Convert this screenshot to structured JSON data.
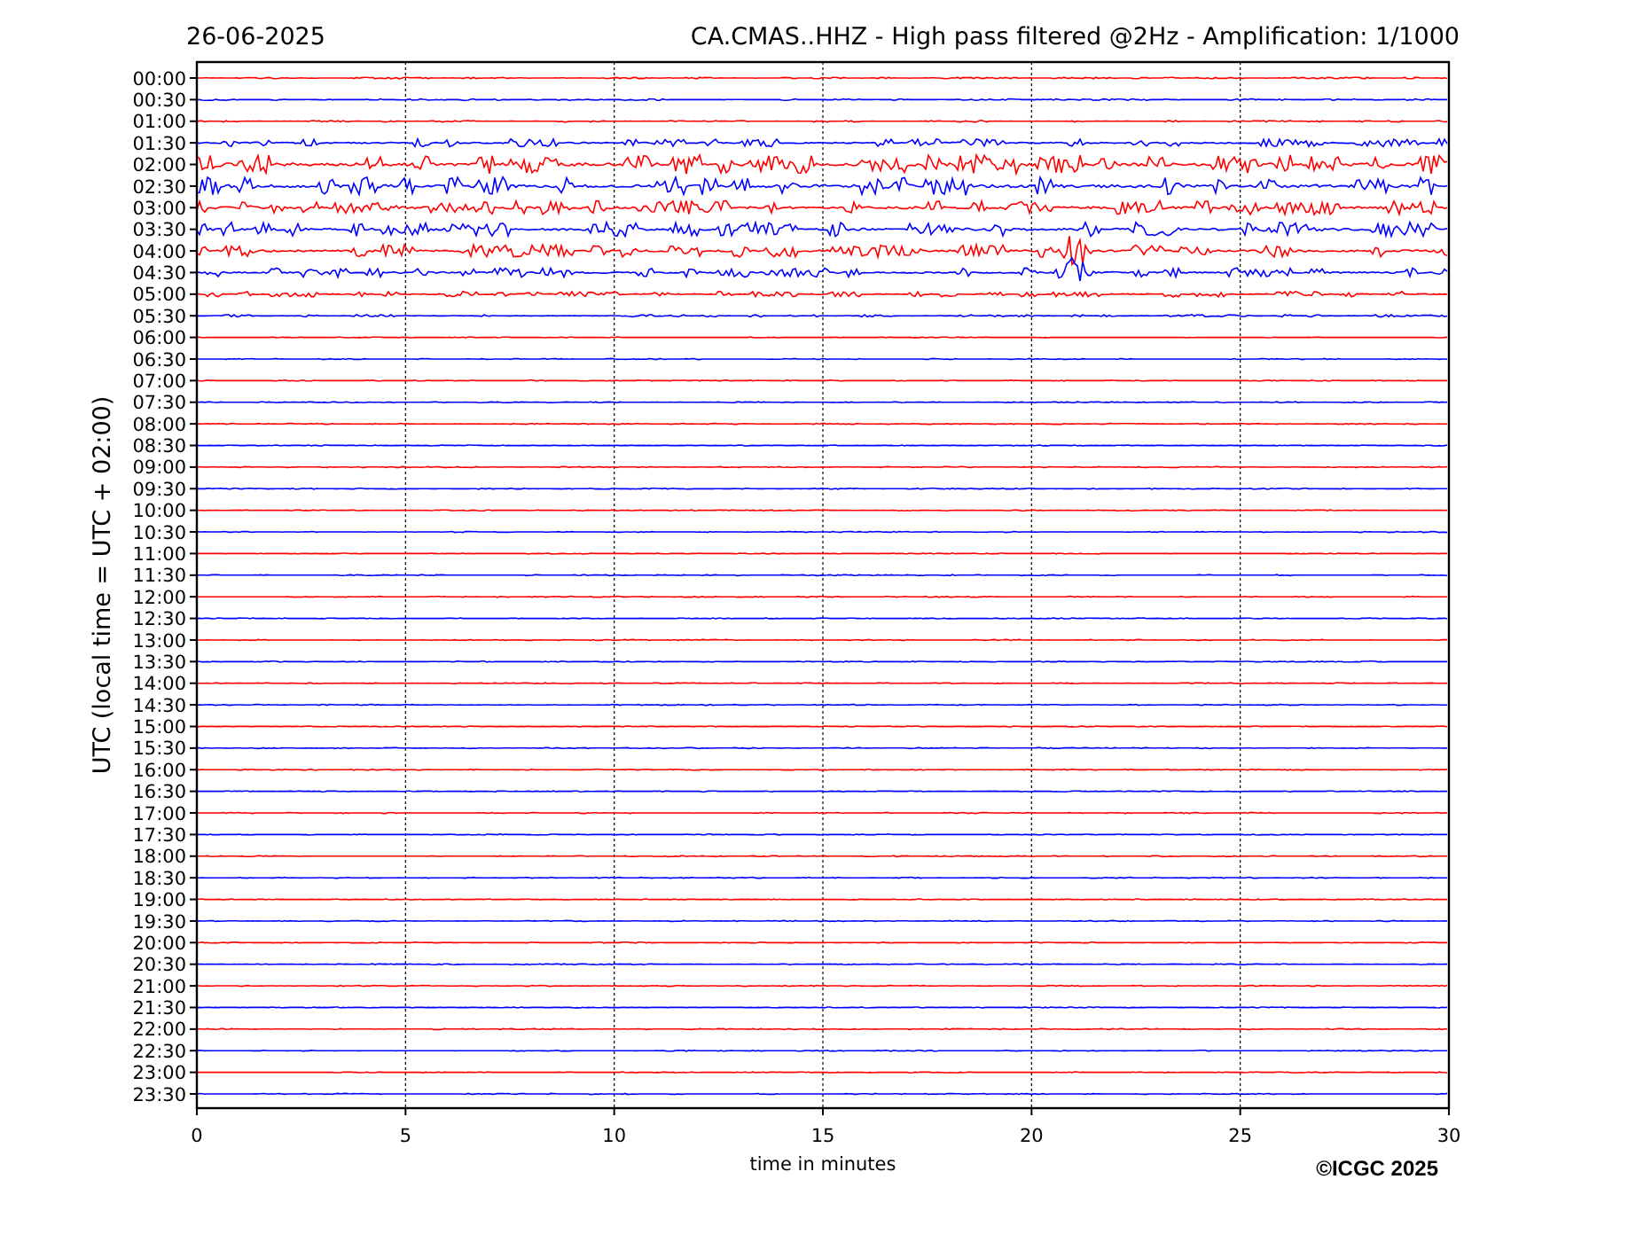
{
  "date": "26-06-2025",
  "title": "CA.CMAS..HHZ - High pass filtered @2Hz - Amplification: 1/1000",
  "ylabel": "UTC (local time = UTC + 02:00)",
  "xlabel": "time in minutes",
  "xticks": [
    "0",
    "5",
    "10",
    "15",
    "20",
    "25",
    "30"
  ],
  "rows": [
    {
      "label": "00:00",
      "color": "#ff0000"
    },
    {
      "label": "00:30",
      "color": "#0000ff"
    },
    {
      "label": "01:00",
      "color": "#ff0000"
    },
    {
      "label": "01:30",
      "color": "#0000ff"
    },
    {
      "label": "02:00",
      "color": "#ff0000"
    },
    {
      "label": "02:30",
      "color": "#0000ff"
    },
    {
      "label": "03:00",
      "color": "#ff0000"
    },
    {
      "label": "03:30",
      "color": "#0000ff"
    },
    {
      "label": "04:00",
      "color": "#ff0000"
    },
    {
      "label": "04:30",
      "color": "#0000ff"
    },
    {
      "label": "05:00",
      "color": "#ff0000"
    },
    {
      "label": "05:30",
      "color": "#0000ff"
    },
    {
      "label": "06:00",
      "color": "#ff0000"
    },
    {
      "label": "06:30",
      "color": "#0000ff"
    },
    {
      "label": "07:00",
      "color": "#ff0000"
    },
    {
      "label": "07:30",
      "color": "#0000ff"
    },
    {
      "label": "08:00",
      "color": "#ff0000"
    },
    {
      "label": "08:30",
      "color": "#0000ff"
    },
    {
      "label": "09:00",
      "color": "#ff0000"
    },
    {
      "label": "09:30",
      "color": "#0000ff"
    },
    {
      "label": "10:00",
      "color": "#ff0000"
    },
    {
      "label": "10:30",
      "color": "#0000ff"
    },
    {
      "label": "11:00",
      "color": "#ff0000"
    },
    {
      "label": "11:30",
      "color": "#0000ff"
    },
    {
      "label": "12:00",
      "color": "#ff0000"
    },
    {
      "label": "12:30",
      "color": "#0000ff"
    },
    {
      "label": "13:00",
      "color": "#ff0000"
    },
    {
      "label": "13:30",
      "color": "#0000ff"
    },
    {
      "label": "14:00",
      "color": "#ff0000"
    },
    {
      "label": "14:30",
      "color": "#0000ff"
    },
    {
      "label": "15:00",
      "color": "#ff0000"
    },
    {
      "label": "15:30",
      "color": "#0000ff"
    },
    {
      "label": "16:00",
      "color": "#ff0000"
    },
    {
      "label": "16:30",
      "color": "#0000ff"
    },
    {
      "label": "17:00",
      "color": "#ff0000"
    },
    {
      "label": "17:30",
      "color": "#0000ff"
    },
    {
      "label": "18:00",
      "color": "#ff0000"
    },
    {
      "label": "18:30",
      "color": "#0000ff"
    },
    {
      "label": "19:00",
      "color": "#ff0000"
    },
    {
      "label": "19:30",
      "color": "#0000ff"
    },
    {
      "label": "20:00",
      "color": "#ff0000"
    },
    {
      "label": "20:30",
      "color": "#0000ff"
    },
    {
      "label": "21:00",
      "color": "#ff0000"
    },
    {
      "label": "21:30",
      "color": "#0000ff"
    },
    {
      "label": "22:00",
      "color": "#ff0000"
    },
    {
      "label": "22:30",
      "color": "#0000ff"
    },
    {
      "label": "23:00",
      "color": "#ff0000"
    },
    {
      "label": "23:30",
      "color": "#0000ff"
    }
  ],
  "copyright": "©ICGC 2025"
}
